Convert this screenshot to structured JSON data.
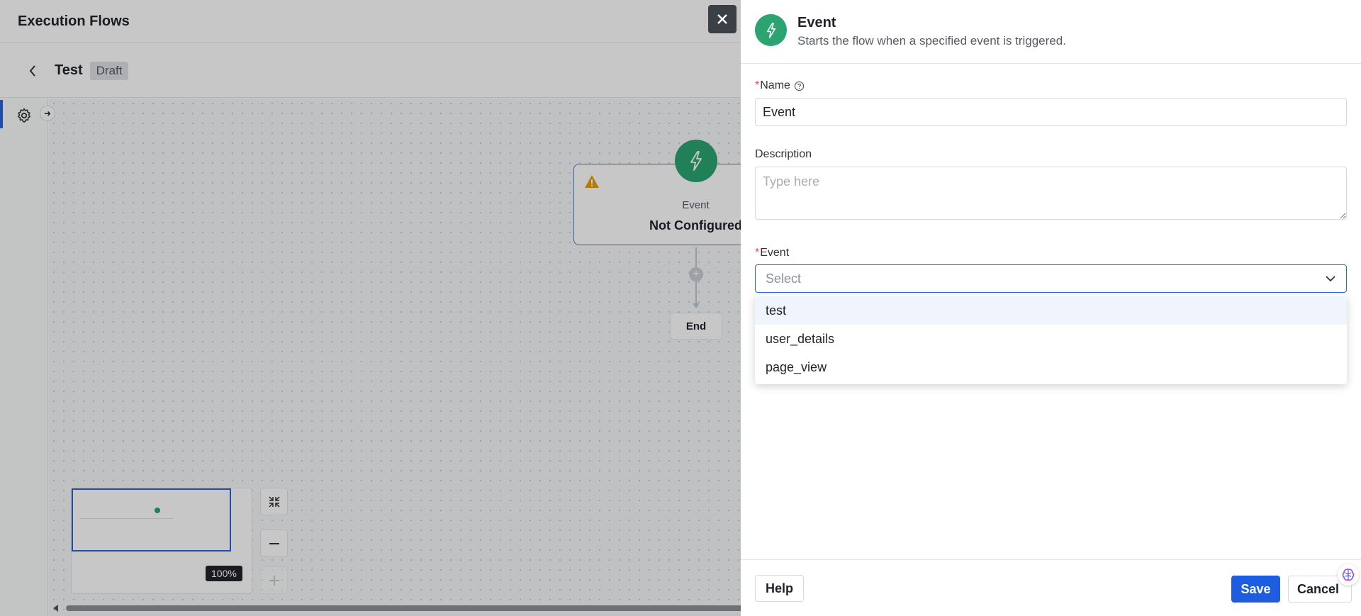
{
  "app": {
    "title": "Execution Flows"
  },
  "flow": {
    "name": "Test",
    "status": "Draft"
  },
  "canvas": {
    "trigger_node": {
      "type": "Event",
      "status": "Not Configured"
    },
    "end_node": {
      "label": "End"
    },
    "zoom": "100%"
  },
  "drawer": {
    "title": "Event",
    "subtitle": "Starts the flow when a specified event is triggered.",
    "fields": {
      "name": {
        "label": "Name",
        "value": "Event",
        "required": true
      },
      "description": {
        "label": "Description",
        "placeholder": "Type here"
      },
      "event": {
        "label": "Event",
        "placeholder": "Select",
        "required": true
      }
    },
    "event_options": [
      "test",
      "user_details",
      "page_view"
    ],
    "footer": {
      "help": "Help",
      "save": "Save",
      "cancel": "Cancel"
    }
  },
  "colors": {
    "accent": "#1f5de0",
    "event_green": "#2ba471",
    "required": "#e34d59"
  },
  "icons": [
    "close-icon",
    "chevron-left-icon",
    "gear-icon",
    "arrow-right-icon",
    "lightning-icon",
    "warning-icon",
    "help-circle-icon",
    "chevron-down-icon",
    "collapse-icon",
    "minus-icon",
    "plus-icon",
    "brain-icon"
  ]
}
